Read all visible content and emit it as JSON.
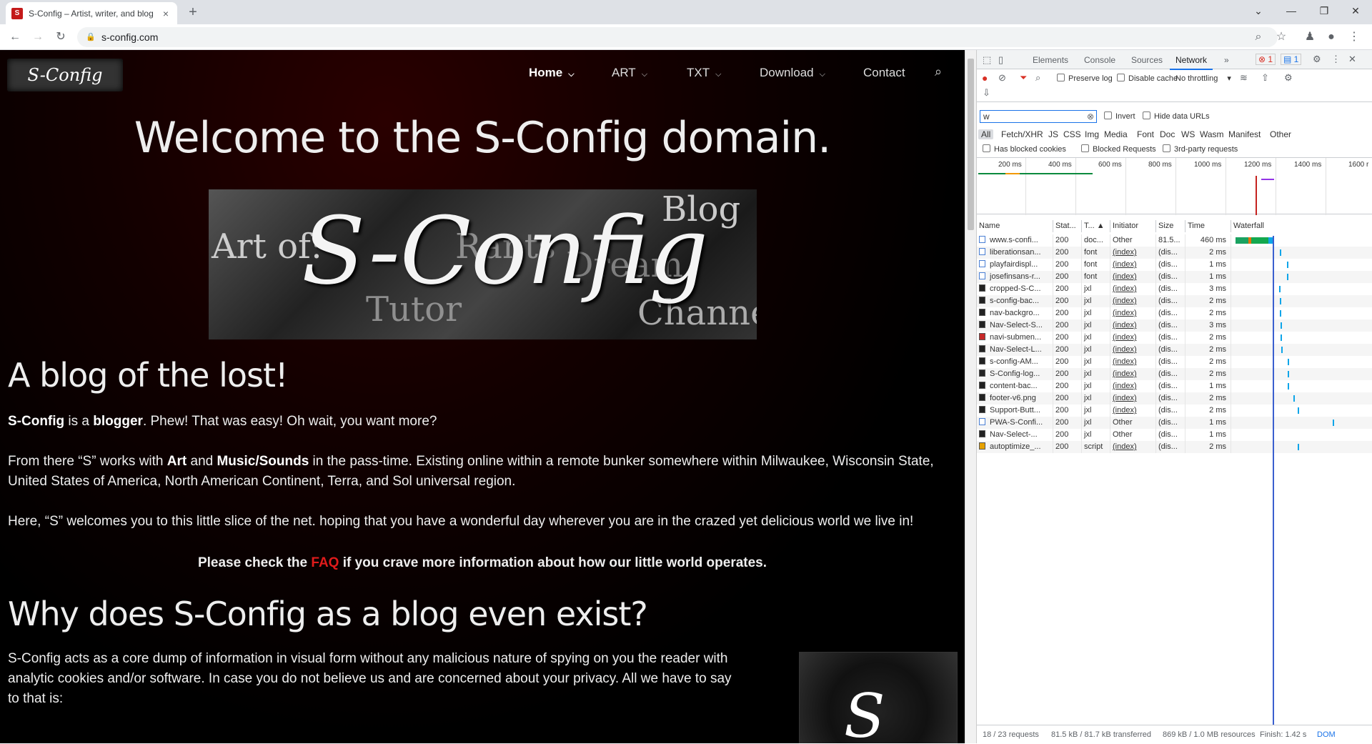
{
  "browser": {
    "tab_title": "S-Config – Artist, writer, and blog",
    "tab_close": "×",
    "new_tab": "+",
    "url": "s-config.com"
  },
  "site": {
    "logo_text": "S-Config",
    "nav": [
      {
        "label": "Home"
      },
      {
        "label": "ART"
      },
      {
        "label": "TXT"
      },
      {
        "label": "Download"
      },
      {
        "label": "Contact"
      }
    ],
    "welcome": "Welcome to the S-Config domain.",
    "banner": {
      "main": "S-Config",
      "art_of": "Art of:",
      "blog": "Blog",
      "rants": "Rants",
      "dream": "Dream",
      "tutor": "Tutor",
      "channel": "Channel"
    },
    "h2_1": "A blog of the lost!",
    "p1_a": "S-Config",
    "p1_b": " is a ",
    "p1_c": "blogger",
    "p1_d": ". Phew! That was easy! Oh wait, you want more?",
    "p2_a": "From there “S” works with ",
    "p2_b": "Art",
    "p2_c": " and ",
    "p2_d": "Music/Sounds",
    "p2_e": " in the pass-time. Existing online within a remote bunker somewhere within Milwaukee, Wisconsin State, United States of America, North American Continent, Terra, and Sol universal region.",
    "p3": "Here, “S” welcomes you to this little slice of the net. hoping that you have a wonderful day wherever you are in the crazed yet delicious world we live in!",
    "faq_a": "Please check the ",
    "faq_link": "FAQ",
    "faq_b": " if you crave more information about how our little world operates.",
    "h2_2": "Why does S-Config as a blog even exist?",
    "p4": "S-Config acts as a core dump of information in visual form without any malicious nature of spying on you the reader with analytic cookies and/or software. In case you do not believe us and are concerned about your privacy. All we have to say to that is:",
    "side_glyph": "S"
  },
  "devtools": {
    "tabs": [
      "Elements",
      "Console",
      "Sources",
      "Network"
    ],
    "more": "»",
    "errors": "1",
    "messages": "1",
    "preserve_log": "Preserve log",
    "disable_cache": "Disable cache",
    "throttling": "No throttling",
    "filter_value": "w",
    "invert": "Invert",
    "hide_data_urls": "Hide data URLs",
    "types": [
      "All",
      "Fetch/XHR",
      "JS",
      "CSS",
      "Img",
      "Media",
      "Font",
      "Doc",
      "WS",
      "Wasm",
      "Manifest",
      "Other"
    ],
    "has_blocked_cookies": "Has blocked cookies",
    "blocked_requests": "Blocked Requests",
    "third_party": "3rd-party requests",
    "ticks": [
      "200 ms",
      "400 ms",
      "600 ms",
      "800 ms",
      "1000 ms",
      "1200 ms",
      "1400 ms",
      "1600 r"
    ],
    "columns": [
      "Name",
      "Stat...",
      "T...",
      "Initiator",
      "Size",
      "Time",
      "Waterfall"
    ],
    "rows": [
      {
        "name": "www.s-confi...",
        "status": "200",
        "type": "doc...",
        "initiator": "Other",
        "size": "81.5...",
        "time": "460 ms",
        "icon": "doc"
      },
      {
        "name": "liberationsan...",
        "status": "200",
        "type": "font",
        "initiator": "(index)",
        "size": "(dis...",
        "time": "2 ms",
        "icon": "font"
      },
      {
        "name": "playfairdispl...",
        "status": "200",
        "type": "font",
        "initiator": "(index)",
        "size": "(dis...",
        "time": "1 ms",
        "icon": "font"
      },
      {
        "name": "josefinsans-r...",
        "status": "200",
        "type": "font",
        "initiator": "(index)",
        "size": "(dis...",
        "time": "1 ms",
        "icon": "font"
      },
      {
        "name": "cropped-S-C...",
        "status": "200",
        "type": "jxl",
        "initiator": "(index)",
        "size": "(dis...",
        "time": "3 ms",
        "icon": "img"
      },
      {
        "name": "s-config-bac...",
        "status": "200",
        "type": "jxl",
        "initiator": "(index)",
        "size": "(dis...",
        "time": "2 ms",
        "icon": "img"
      },
      {
        "name": "nav-backgro...",
        "status": "200",
        "type": "jxl",
        "initiator": "(index)",
        "size": "(dis...",
        "time": "2 ms",
        "icon": "img"
      },
      {
        "name": "Nav-Select-S...",
        "status": "200",
        "type": "jxl",
        "initiator": "(index)",
        "size": "(dis...",
        "time": "3 ms",
        "icon": "img"
      },
      {
        "name": "navi-submen...",
        "status": "200",
        "type": "jxl",
        "initiator": "(index)",
        "size": "(dis...",
        "time": "2 ms",
        "icon": "imgred"
      },
      {
        "name": "Nav-Select-L...",
        "status": "200",
        "type": "jxl",
        "initiator": "(index)",
        "size": "(dis...",
        "time": "2 ms",
        "icon": "img"
      },
      {
        "name": "s-config-AM...",
        "status": "200",
        "type": "jxl",
        "initiator": "(index)",
        "size": "(dis...",
        "time": "2 ms",
        "icon": "img"
      },
      {
        "name": "S-Config-log...",
        "status": "200",
        "type": "jxl",
        "initiator": "(index)",
        "size": "(dis...",
        "time": "2 ms",
        "icon": "img"
      },
      {
        "name": "content-bac...",
        "status": "200",
        "type": "jxl",
        "initiator": "(index)",
        "size": "(dis...",
        "time": "1 ms",
        "icon": "img"
      },
      {
        "name": "footer-v6.png",
        "status": "200",
        "type": "jxl",
        "initiator": "(index)",
        "size": "(dis...",
        "time": "2 ms",
        "icon": "img"
      },
      {
        "name": "Support-Butt...",
        "status": "200",
        "type": "jxl",
        "initiator": "(index)",
        "size": "(dis...",
        "time": "2 ms",
        "icon": "img"
      },
      {
        "name": "PWA-S-Confi...",
        "status": "200",
        "type": "jxl",
        "initiator": "Other",
        "size": "(dis...",
        "time": "1 ms",
        "icon": "blank"
      },
      {
        "name": "Nav-Select-...",
        "status": "200",
        "type": "jxl",
        "initiator": "Other",
        "size": "(dis...",
        "time": "1 ms",
        "icon": "img"
      },
      {
        "name": "autoptimize_...",
        "status": "200",
        "type": "script",
        "initiator": "(index)",
        "size": "(dis...",
        "time": "2 ms",
        "icon": "script"
      }
    ],
    "status_requests": "18 / 23 requests",
    "status_transferred": "81.5 kB / 81.7 kB transferred",
    "status_resources": "869 kB / 1.0 MB resources",
    "status_finish": "Finish: 1.42 s",
    "status_dom": "DOM"
  }
}
